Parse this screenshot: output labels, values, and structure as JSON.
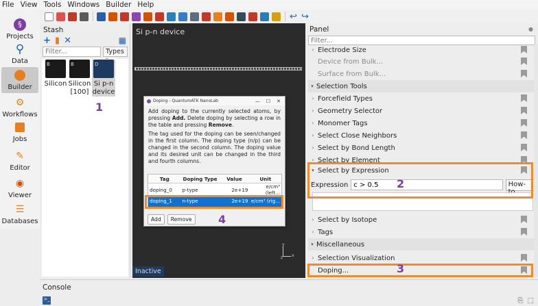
{
  "menu": [
    "File",
    "View",
    "Tools",
    "Windows",
    "Builder",
    "Help"
  ],
  "sidebar": [
    {
      "label": "Projects",
      "icon": "projects-icon"
    },
    {
      "label": "Data",
      "icon": "data-search-icon"
    },
    {
      "label": "Builder",
      "icon": "builder-icon",
      "active": true
    },
    {
      "label": "Workflows",
      "icon": "workflows-icon"
    },
    {
      "label": "Jobs",
      "icon": "jobs-icon"
    },
    {
      "label": "Editor",
      "icon": "editor-icon"
    },
    {
      "label": "Viewer",
      "icon": "viewer-eye-icon"
    },
    {
      "label": "Databases",
      "icon": "databases-icon"
    }
  ],
  "stash": {
    "title": "Stash",
    "filter_placeholder": "Filter...",
    "types_label": "Types",
    "items": [
      {
        "label": "Silicon",
        "thumb_letter": "B"
      },
      {
        "label": "Silicon [100]",
        "thumb_letter": "B"
      },
      {
        "label": "Si p-n device",
        "thumb_letter": "D",
        "selected": true
      }
    ]
  },
  "viewport": {
    "title": "Si p-n device",
    "status": "Inactive",
    "axes": [
      "y",
      "z",
      "x"
    ]
  },
  "dialog": {
    "title": "Doping - QuantumATK NanoLab",
    "para1_a": "Add doping to the currently selected atoms, by pressing ",
    "para1_add": "Add.",
    "para1_b": " Delete doping by selecting a row in the table and pressing ",
    "para1_remove": "Remove",
    "para1_end": ".",
    "para2": "The tag used for the doping can be seen/changed in the first column. The doping type (n/p) can be changed in the second column. The doping value and its desired unit can be changed in the third and fourth columns.",
    "columns": [
      "Tag",
      "Doping Type",
      "Value",
      "Unit"
    ],
    "rows": [
      {
        "tag": "doping_0",
        "type": "p-type",
        "value": "2e+19",
        "unit": "e/cm³ (left..."
      },
      {
        "tag": "doping_1",
        "type": "n-type",
        "value": "2e+19",
        "unit": "e/cm³ (rig...",
        "selected": true
      }
    ],
    "add_label": "Add",
    "remove_label": "Remove"
  },
  "panel": {
    "title": "Panel",
    "filter_placeholder": "Filter...",
    "rows": [
      {
        "label": "Electrode Size",
        "kind": "item"
      },
      {
        "label": "Device from Bulk...",
        "kind": "disabled"
      },
      {
        "label": "Surface from Bulk...",
        "kind": "disabled"
      },
      {
        "label": "Selection Tools",
        "kind": "section"
      },
      {
        "label": "Forcefield Types",
        "kind": "item"
      },
      {
        "label": "Geometry Selector",
        "kind": "item"
      },
      {
        "label": "Monomer Tags",
        "kind": "item"
      },
      {
        "label": "Select Close Neighbors",
        "kind": "item"
      },
      {
        "label": "Select by Bond Length",
        "kind": "item"
      },
      {
        "label": "Select by Element",
        "kind": "item"
      },
      {
        "label": "Select by Expression",
        "kind": "expanded"
      },
      {
        "label": "Select by Isotope",
        "kind": "item"
      },
      {
        "label": "Tags",
        "kind": "item"
      },
      {
        "label": "Miscellaneous",
        "kind": "section"
      },
      {
        "label": "Selection Visualization",
        "kind": "item"
      },
      {
        "label": "Doping...",
        "kind": "item"
      }
    ],
    "expression_label": "Expression",
    "expression_value": "c > 0.5",
    "howto_label": "How-to"
  },
  "console": {
    "title": "Console"
  },
  "annotations": [
    "1",
    "2",
    "3",
    "4"
  ],
  "colors": {
    "highlight": "#f08a2b",
    "annotation_number": "#7b3fa0",
    "selection_blue": "#0f72d0"
  }
}
